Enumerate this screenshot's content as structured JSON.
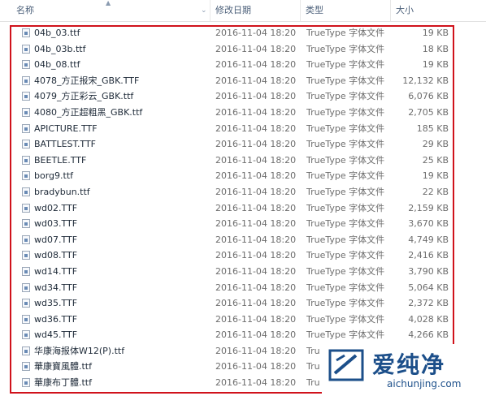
{
  "columns": {
    "name": "名称",
    "date": "修改日期",
    "type": "类型",
    "size": "大小"
  },
  "files": [
    {
      "name": "04b_03.ttf",
      "date": "2016-11-04 18:20",
      "type": "TrueType 字体文件",
      "size": "19 KB"
    },
    {
      "name": "04b_03b.ttf",
      "date": "2016-11-04 18:20",
      "type": "TrueType 字体文件",
      "size": "18 KB"
    },
    {
      "name": "04b_08.ttf",
      "date": "2016-11-04 18:20",
      "type": "TrueType 字体文件",
      "size": "19 KB"
    },
    {
      "name": "4078_方正报宋_GBK.TTF",
      "date": "2016-11-04 18:20",
      "type": "TrueType 字体文件",
      "size": "12,132 KB"
    },
    {
      "name": "4079_方正彩云_GBK.ttf",
      "date": "2016-11-04 18:20",
      "type": "TrueType 字体文件",
      "size": "6,076 KB"
    },
    {
      "name": "4080_方正超粗黑_GBK.ttf",
      "date": "2016-11-04 18:20",
      "type": "TrueType 字体文件",
      "size": "2,705 KB"
    },
    {
      "name": "APICTURE.TTF",
      "date": "2016-11-04 18:20",
      "type": "TrueType 字体文件",
      "size": "185 KB"
    },
    {
      "name": "BATTLEST.TTF",
      "date": "2016-11-04 18:20",
      "type": "TrueType 字体文件",
      "size": "29 KB"
    },
    {
      "name": "BEETLE.TTF",
      "date": "2016-11-04 18:20",
      "type": "TrueType 字体文件",
      "size": "25 KB"
    },
    {
      "name": "borg9.ttf",
      "date": "2016-11-04 18:20",
      "type": "TrueType 字体文件",
      "size": "19 KB"
    },
    {
      "name": "bradybun.ttf",
      "date": "2016-11-04 18:20",
      "type": "TrueType 字体文件",
      "size": "22 KB"
    },
    {
      "name": "wd02.TTF",
      "date": "2016-11-04 18:20",
      "type": "TrueType 字体文件",
      "size": "2,159 KB"
    },
    {
      "name": "wd03.TTF",
      "date": "2016-11-04 18:20",
      "type": "TrueType 字体文件",
      "size": "3,670 KB"
    },
    {
      "name": "wd07.TTF",
      "date": "2016-11-04 18:20",
      "type": "TrueType 字体文件",
      "size": "4,749 KB"
    },
    {
      "name": "wd08.TTF",
      "date": "2016-11-04 18:20",
      "type": "TrueType 字体文件",
      "size": "2,416 KB"
    },
    {
      "name": "wd14.TTF",
      "date": "2016-11-04 18:20",
      "type": "TrueType 字体文件",
      "size": "3,790 KB"
    },
    {
      "name": "wd34.TTF",
      "date": "2016-11-04 18:20",
      "type": "TrueType 字体文件",
      "size": "5,064 KB"
    },
    {
      "name": "wd35.TTF",
      "date": "2016-11-04 18:20",
      "type": "TrueType 字体文件",
      "size": "2,372 KB"
    },
    {
      "name": "wd36.TTF",
      "date": "2016-11-04 18:20",
      "type": "TrueType 字体文件",
      "size": "4,028 KB"
    },
    {
      "name": "wd45.TTF",
      "date": "2016-11-04 18:20",
      "type": "TrueType 字体文件",
      "size": "4,266 KB"
    },
    {
      "name": "华康海报体W12(P).ttf",
      "date": "2016-11-04 18:20",
      "type": "Tru",
      "size": ""
    },
    {
      "name": "華康寶風體.ttf",
      "date": "2016-11-04 18:20",
      "type": "Tru",
      "size": ""
    },
    {
      "name": "華康布丁體.ttf",
      "date": "2016-11-04 18:20",
      "type": "Tru",
      "size": ""
    }
  ],
  "watermark": {
    "text": "爱纯净",
    "url": "aichunjing.com"
  },
  "colors": {
    "highlight": "#d0121b",
    "header_text": "#4c607a",
    "logo": "#1c4f8a"
  }
}
